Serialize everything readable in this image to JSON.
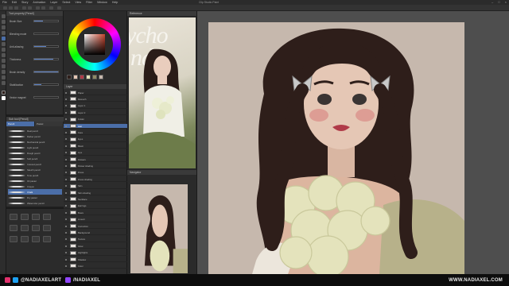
{
  "app": {
    "title": "Clip Studio Paint",
    "menu": [
      "File",
      "Edit",
      "Story",
      "Animation",
      "Layer",
      "Select",
      "View",
      "Filter",
      "Window",
      "Help"
    ]
  },
  "tool_property": {
    "header": "Tool property [Pencil]",
    "rows": [
      {
        "label": "Brush Size",
        "value": 0.35
      },
      {
        "label": "Blending mode",
        "value": 0.0
      },
      {
        "label": "Anti-aliasing",
        "value": 0.5
      },
      {
        "label": "Thickness",
        "value": 0.8
      },
      {
        "label": "Brush density",
        "value": 1.0
      },
      {
        "label": "Stabilization",
        "value": 0.3
      },
      {
        "label": "Vector magnet",
        "value": 0.0
      }
    ]
  },
  "sub_tool": {
    "header": "Sub tool [Pencil]",
    "tabs": [
      "Pencil",
      "Pastel"
    ],
    "active_tab": 0,
    "brushes": [
      "Real pencil",
      "Darker pencil",
      "Mechanical pencil",
      "Light pencil",
      "Rough pencil",
      "Soft pencil",
      "Colored pencil",
      "Sketch pencil",
      "Tone pencil",
      "Oil pastel",
      "Crayon",
      "Chalk",
      "Dry pastel",
      "Watercolor pencil"
    ],
    "selected": 11
  },
  "layers": {
    "header": "Layer",
    "items": [
      "Paper",
      "Retouch",
      "Layer 1",
      "Layer 2",
      "Folder",
      "Hair",
      "Face",
      "Eyes",
      "Blush",
      "Lips",
      "Flowers",
      "Flower shading",
      "Dress",
      "Dress shading",
      "Skin",
      "Skin shading",
      "Necklace",
      "Earrings",
      "Bows",
      "Lineart",
      "Correction",
      "Background",
      "Texture",
      "Glow",
      "Highlights",
      "Shadow",
      "Color"
    ],
    "selected": 5
  },
  "reference": {
    "header": "Reference",
    "words": [
      "ycho",
      "ndy"
    ]
  },
  "navigator": {
    "header": "Navigator"
  },
  "colors": {
    "accent": "#4b6ea8",
    "canvas_bg": "#c6b8ad",
    "hair": "#2e1e1a",
    "skin": "#e5c7b5",
    "flowers": "#e4e3bc",
    "dress": "#b7b18a",
    "swatches": [
      "#2e1e1a",
      "#e5c7b5",
      "#b03a48",
      "#e4e3bc",
      "#8f8a64",
      "#c6b8ad"
    ]
  },
  "footer": {
    "instagram": "@NADIAXELART",
    "twitch": "/NADIAXEL",
    "website": "WWW.NADIAXEL.COM"
  }
}
